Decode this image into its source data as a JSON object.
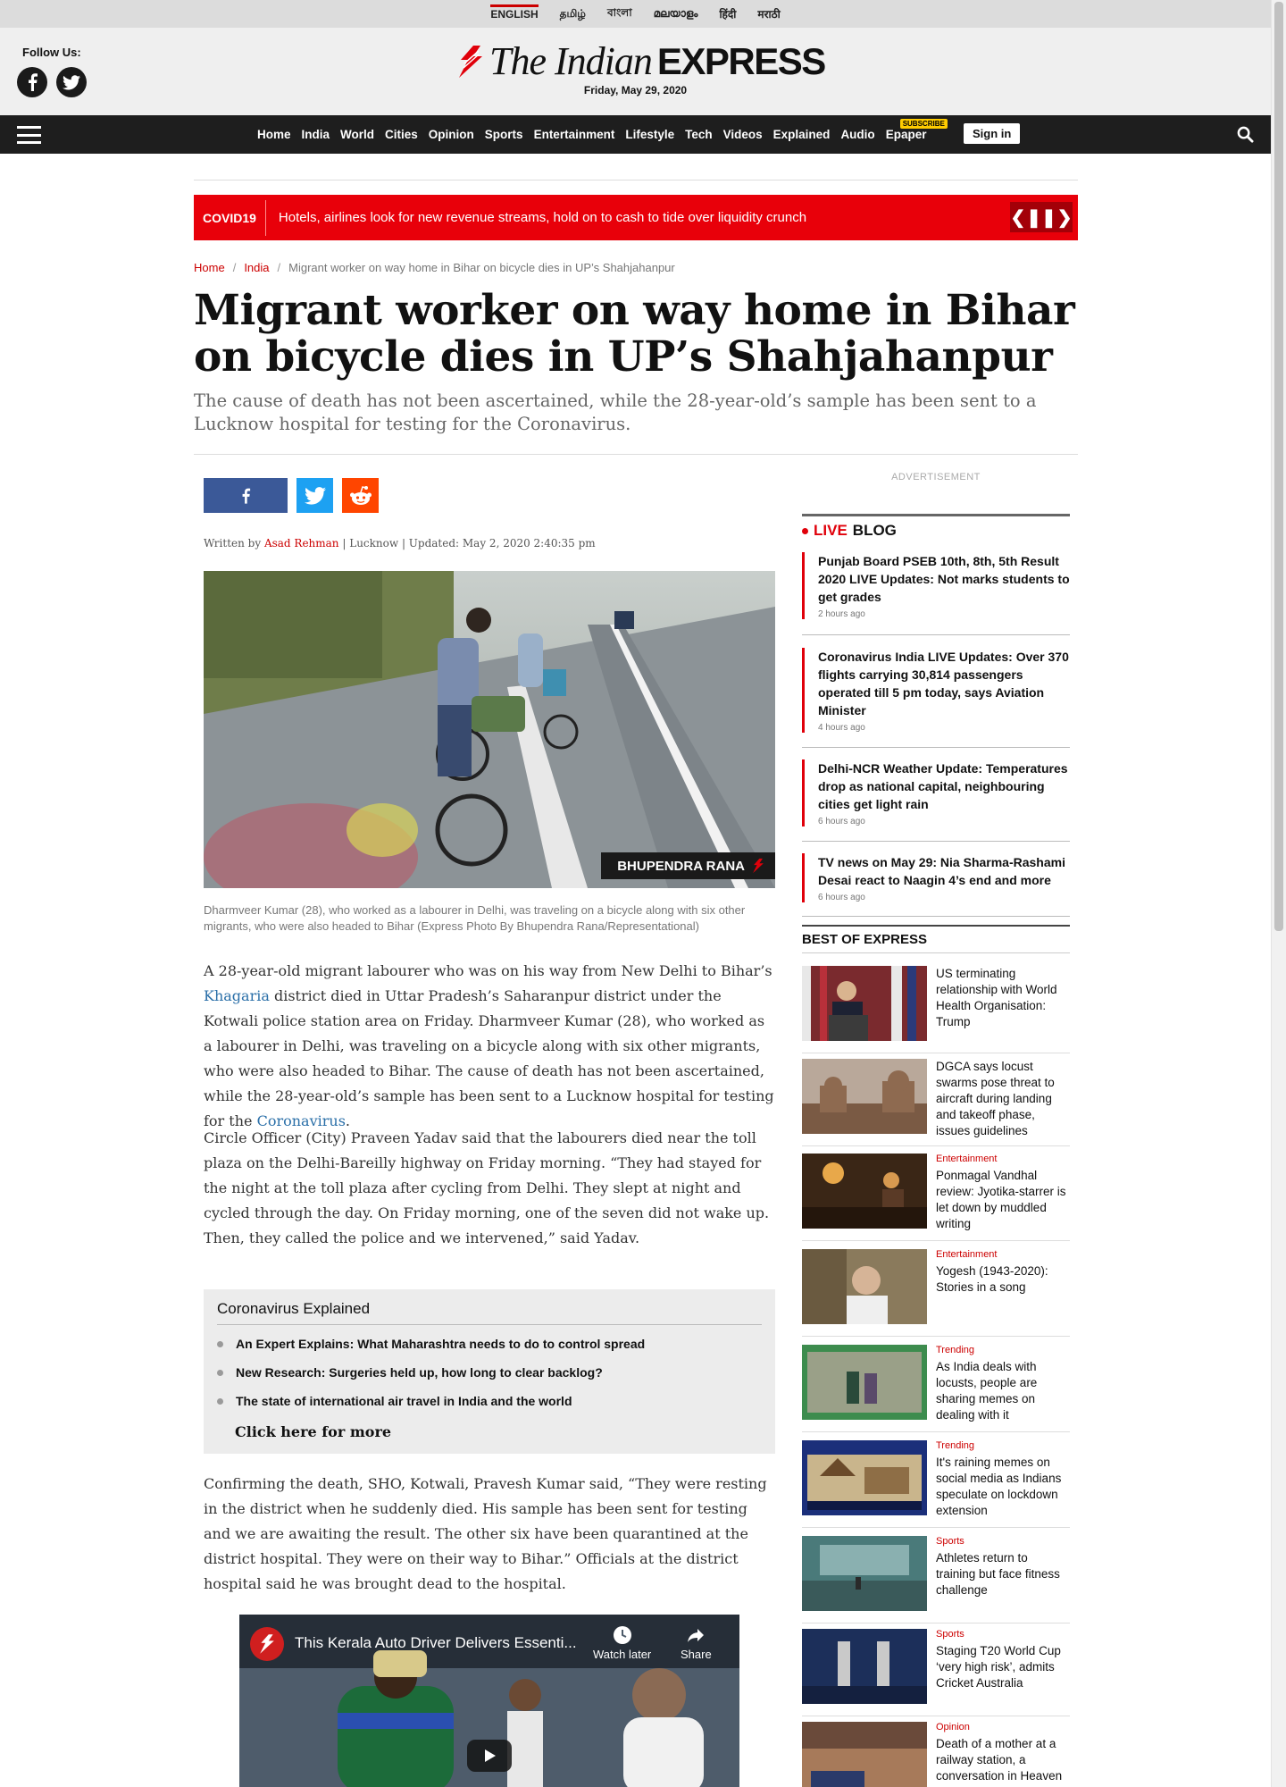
{
  "languages": [
    "ENGLISH",
    "தமிழ்",
    "বাংলা",
    "മലയാളം",
    "हिंदी",
    "मराठी"
  ],
  "masthead": {
    "follow_label": "Follow Us:",
    "logo_part1": "The Indian",
    "logo_part2": "EXPRESS",
    "date": "Friday, May 29, 2020"
  },
  "nav": {
    "items": [
      "Home",
      "India",
      "World",
      "Cities",
      "Opinion",
      "Sports",
      "Entertainment",
      "Lifestyle",
      "Tech",
      "Videos",
      "Explained",
      "Audio",
      "Epaper"
    ],
    "subscribe_badge": "SUBSCRIBE",
    "signin": "Sign in"
  },
  "covid": {
    "tag": "COVID19",
    "headline": "Hotels, airlines look for new revenue streams, hold on to cash to tide over liquidity crunch"
  },
  "breadcrumb": {
    "home": "Home",
    "section": "India",
    "current": "Migrant worker on way home in Bihar on bicycle dies in UP’s Shahjahanpur"
  },
  "article": {
    "headline": "Migrant worker on way home in Bihar on bicycle dies in UP’s Shahjahanpur",
    "subhead": "The cause of death has not been ascertained, while the 28-year-old’s sample has been sent to a Lucknow hospital for testing for the Coronavirus.",
    "byline": {
      "prefix": "Written by ",
      "author": "Asad Rehman",
      "rest": " | Lucknow | Updated: May 2, 2020 2:40:35 pm"
    },
    "photo_credit": "BHUPENDRA RANA",
    "caption": "Dharmveer Kumar (28), who worked as a labourer in Delhi, was traveling on a bicycle along with six other migrants, who were also headed to Bihar (Express Photo By Bhupendra Rana/Representational)",
    "p1_a": "A 28-year-old migrant labourer who was on his way from New Delhi to Bihar’s ",
    "p1_link1": "Khagaria",
    "p1_b": " district died in Uttar Pradesh’s Saharanpur district under the Kotwali police station area on Friday. Dharmveer Kumar (28), who worked as a labourer in Delhi, was traveling on a bicycle along with six other migrants, who were also headed to Bihar. The cause of death has not been ascertained, while the 28-year-old’s sample has been sent to a Lucknow hospital for testing for the ",
    "p1_link2": "Coronavirus",
    "p1_c": ".",
    "p2": "Circle Officer (City) Praveen Yadav said that the labourers died near the toll plaza on the Delhi-Bareilly highway on Friday morning. “They had stayed for the night at the toll plaza after cycling from Delhi. They slept at night and cycled through the day. On Friday morning, one of the seven did not wake up. Then, they called the police and we intervened,” said Yadav.",
    "p3": "Confirming the death, SHO, Kotwali, Pravesh Kumar said, “They were resting in the district when he suddenly died. His sample has been sent for testing and we are awaiting the result. The other six have been quarantined at the district hospital. They were on their way to Bihar.” Officials at the district hospital said he was brought dead to the hospital."
  },
  "explained": {
    "title": "Coronavirus Explained",
    "items": [
      "An Expert Explains: What Maharashtra needs to do to control spread",
      "New Research: Surgeries held up, how long to clear backlog?",
      "The state of international air travel in India and the world"
    ],
    "more": "Click here for more"
  },
  "video": {
    "title": "This Kerala Auto Driver Delivers Essenti...",
    "watch_later": "Watch later",
    "share": "Share"
  },
  "sidebar": {
    "advertisement": "ADVERTISEMENT",
    "live_word": "LIVE",
    "blog_word": "BLOG",
    "live_items": [
      {
        "title": "Punjab Board PSEB 10th, 8th, 5th Result 2020 LIVE Updates: Not marks students to get grades",
        "time": "2 hours ago"
      },
      {
        "title": "Coronavirus India LIVE Updates: Over 370 flights carrying 30,814 passengers operated till 5 pm today, says Aviation Minister",
        "time": "4 hours ago"
      },
      {
        "title": "Delhi-NCR Weather Update: Temperatures drop as national capital, neighbouring cities get light rain",
        "time": "6 hours ago"
      },
      {
        "title": "TV news on May 29: Nia Sharma-Rashami Desai react to Naagin 4’s end and more",
        "time": "6 hours ago"
      }
    ],
    "best_heading": "BEST OF EXPRESS",
    "best_items": [
      {
        "category": "",
        "title": "US terminating relationship with World Health Organisation: Trump"
      },
      {
        "category": "",
        "title": "DGCA says locust swarms pose threat to aircraft during landing and takeoff phase, issues guidelines"
      },
      {
        "category": "Entertainment",
        "title": "Ponmagal Vandhal review: Jyotika-starrer is let down by muddled writing"
      },
      {
        "category": "Entertainment",
        "title": "Yogesh (1943-2020): Stories in a song"
      },
      {
        "category": "Trending",
        "title": "As India deals with locusts, people are sharing memes on dealing with it"
      },
      {
        "category": "Trending",
        "title": "It's raining memes on social media as Indians speculate on lockdown extension"
      },
      {
        "category": "Sports",
        "title": "Athletes return to training but face fitness challenge"
      },
      {
        "category": "Sports",
        "title": "Staging T20 World Cup ‘very high risk’, admits Cricket Australia"
      },
      {
        "category": "Opinion",
        "title": "Death of a mother at a railway station, a conversation in Heaven"
      }
    ]
  }
}
